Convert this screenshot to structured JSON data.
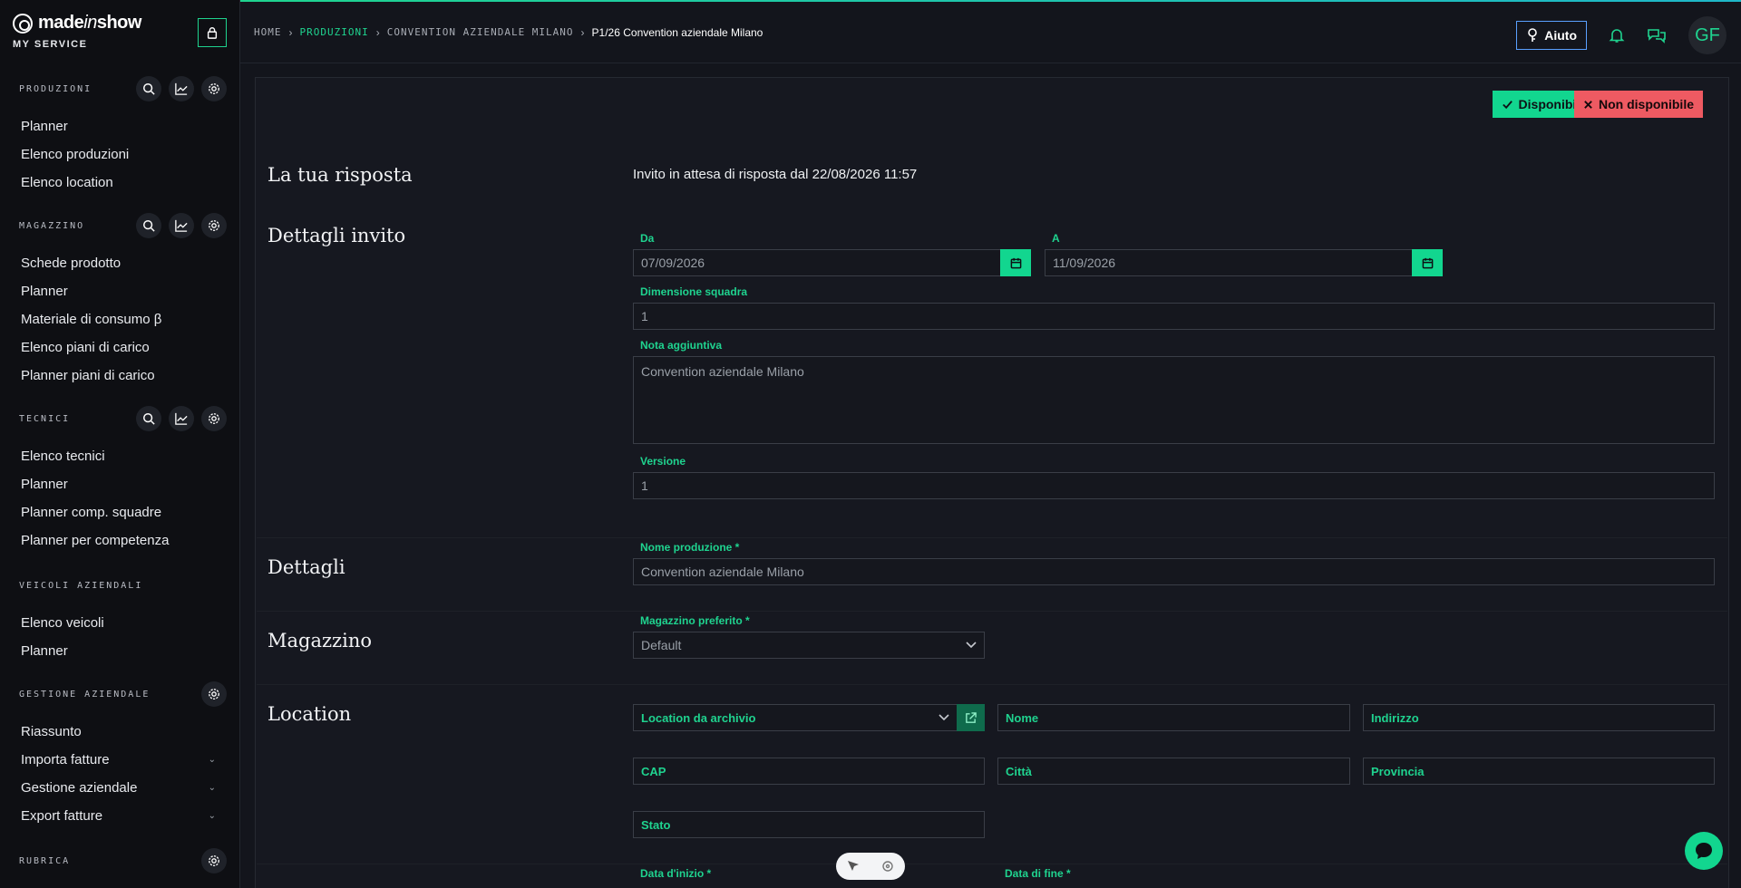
{
  "brand": {
    "name_a": "made",
    "name_b": "in",
    "name_c": "show",
    "subtitle": "MY SERVICE"
  },
  "sidebar": {
    "sections": [
      {
        "title": "PRODUZIONI",
        "items": [
          "Planner",
          "Elenco produzioni",
          "Elenco location"
        ]
      },
      {
        "title": "MAGAZZINO",
        "items": [
          "Schede prodotto",
          "Planner",
          "Materiale di consumo β",
          "Elenco piani di carico",
          "Planner piani di carico"
        ]
      },
      {
        "title": "TECNICI",
        "items": [
          "Elenco tecnici",
          "Planner",
          "Planner comp. squadre",
          "Planner per competenza"
        ]
      },
      {
        "title": "VEICOLI AZIENDALI",
        "items": [
          "Elenco veicoli",
          "Planner"
        ]
      },
      {
        "title": "GESTIONE AZIENDALE",
        "items": [
          "Riassunto",
          "Importa fatture",
          "Gestione aziendale",
          "Export fatture"
        ]
      },
      {
        "title": "RUBRICA",
        "items": []
      }
    ]
  },
  "breadcrumb": {
    "home": "HOME",
    "produzioni": "PRODUZIONI",
    "convention": "CONVENTION AZIENDALE MILANO",
    "current": "P1/26 Convention aziendale Milano"
  },
  "header": {
    "help_label": "Aiuto",
    "avatar_initials": "GF"
  },
  "actions": {
    "available": "Disponibile",
    "unavailable": "Non disponibile"
  },
  "response": {
    "title": "La tua risposta",
    "status": "Invito in attesa di risposta dal 22/08/2026 11:57"
  },
  "invite": {
    "title": "Dettagli invito",
    "from_label": "Da",
    "from_value": "07/09/2026",
    "to_label": "A",
    "to_value": "11/09/2026",
    "team_label": "Dimensione squadra",
    "team_value": "1",
    "note_label": "Nota aggiuntiva",
    "note_value": "Convention aziendale Milano",
    "version_label": "Versione",
    "version_value": "1"
  },
  "details": {
    "title": "Dettagli",
    "name_label": "Nome produzione *",
    "name_value": "Convention aziendale Milano"
  },
  "warehouse": {
    "title": "Magazzino",
    "label": "Magazzino preferito *",
    "value": "Default"
  },
  "location": {
    "title": "Location",
    "archive_label": "Location da archivio",
    "name": "Nome",
    "address": "Indirizzo",
    "zip": "CAP",
    "city": "Città",
    "province": "Provincia",
    "state": "Stato"
  },
  "dates": {
    "start_label": "Data d'inizio *",
    "end_label": "Data di fine *"
  }
}
